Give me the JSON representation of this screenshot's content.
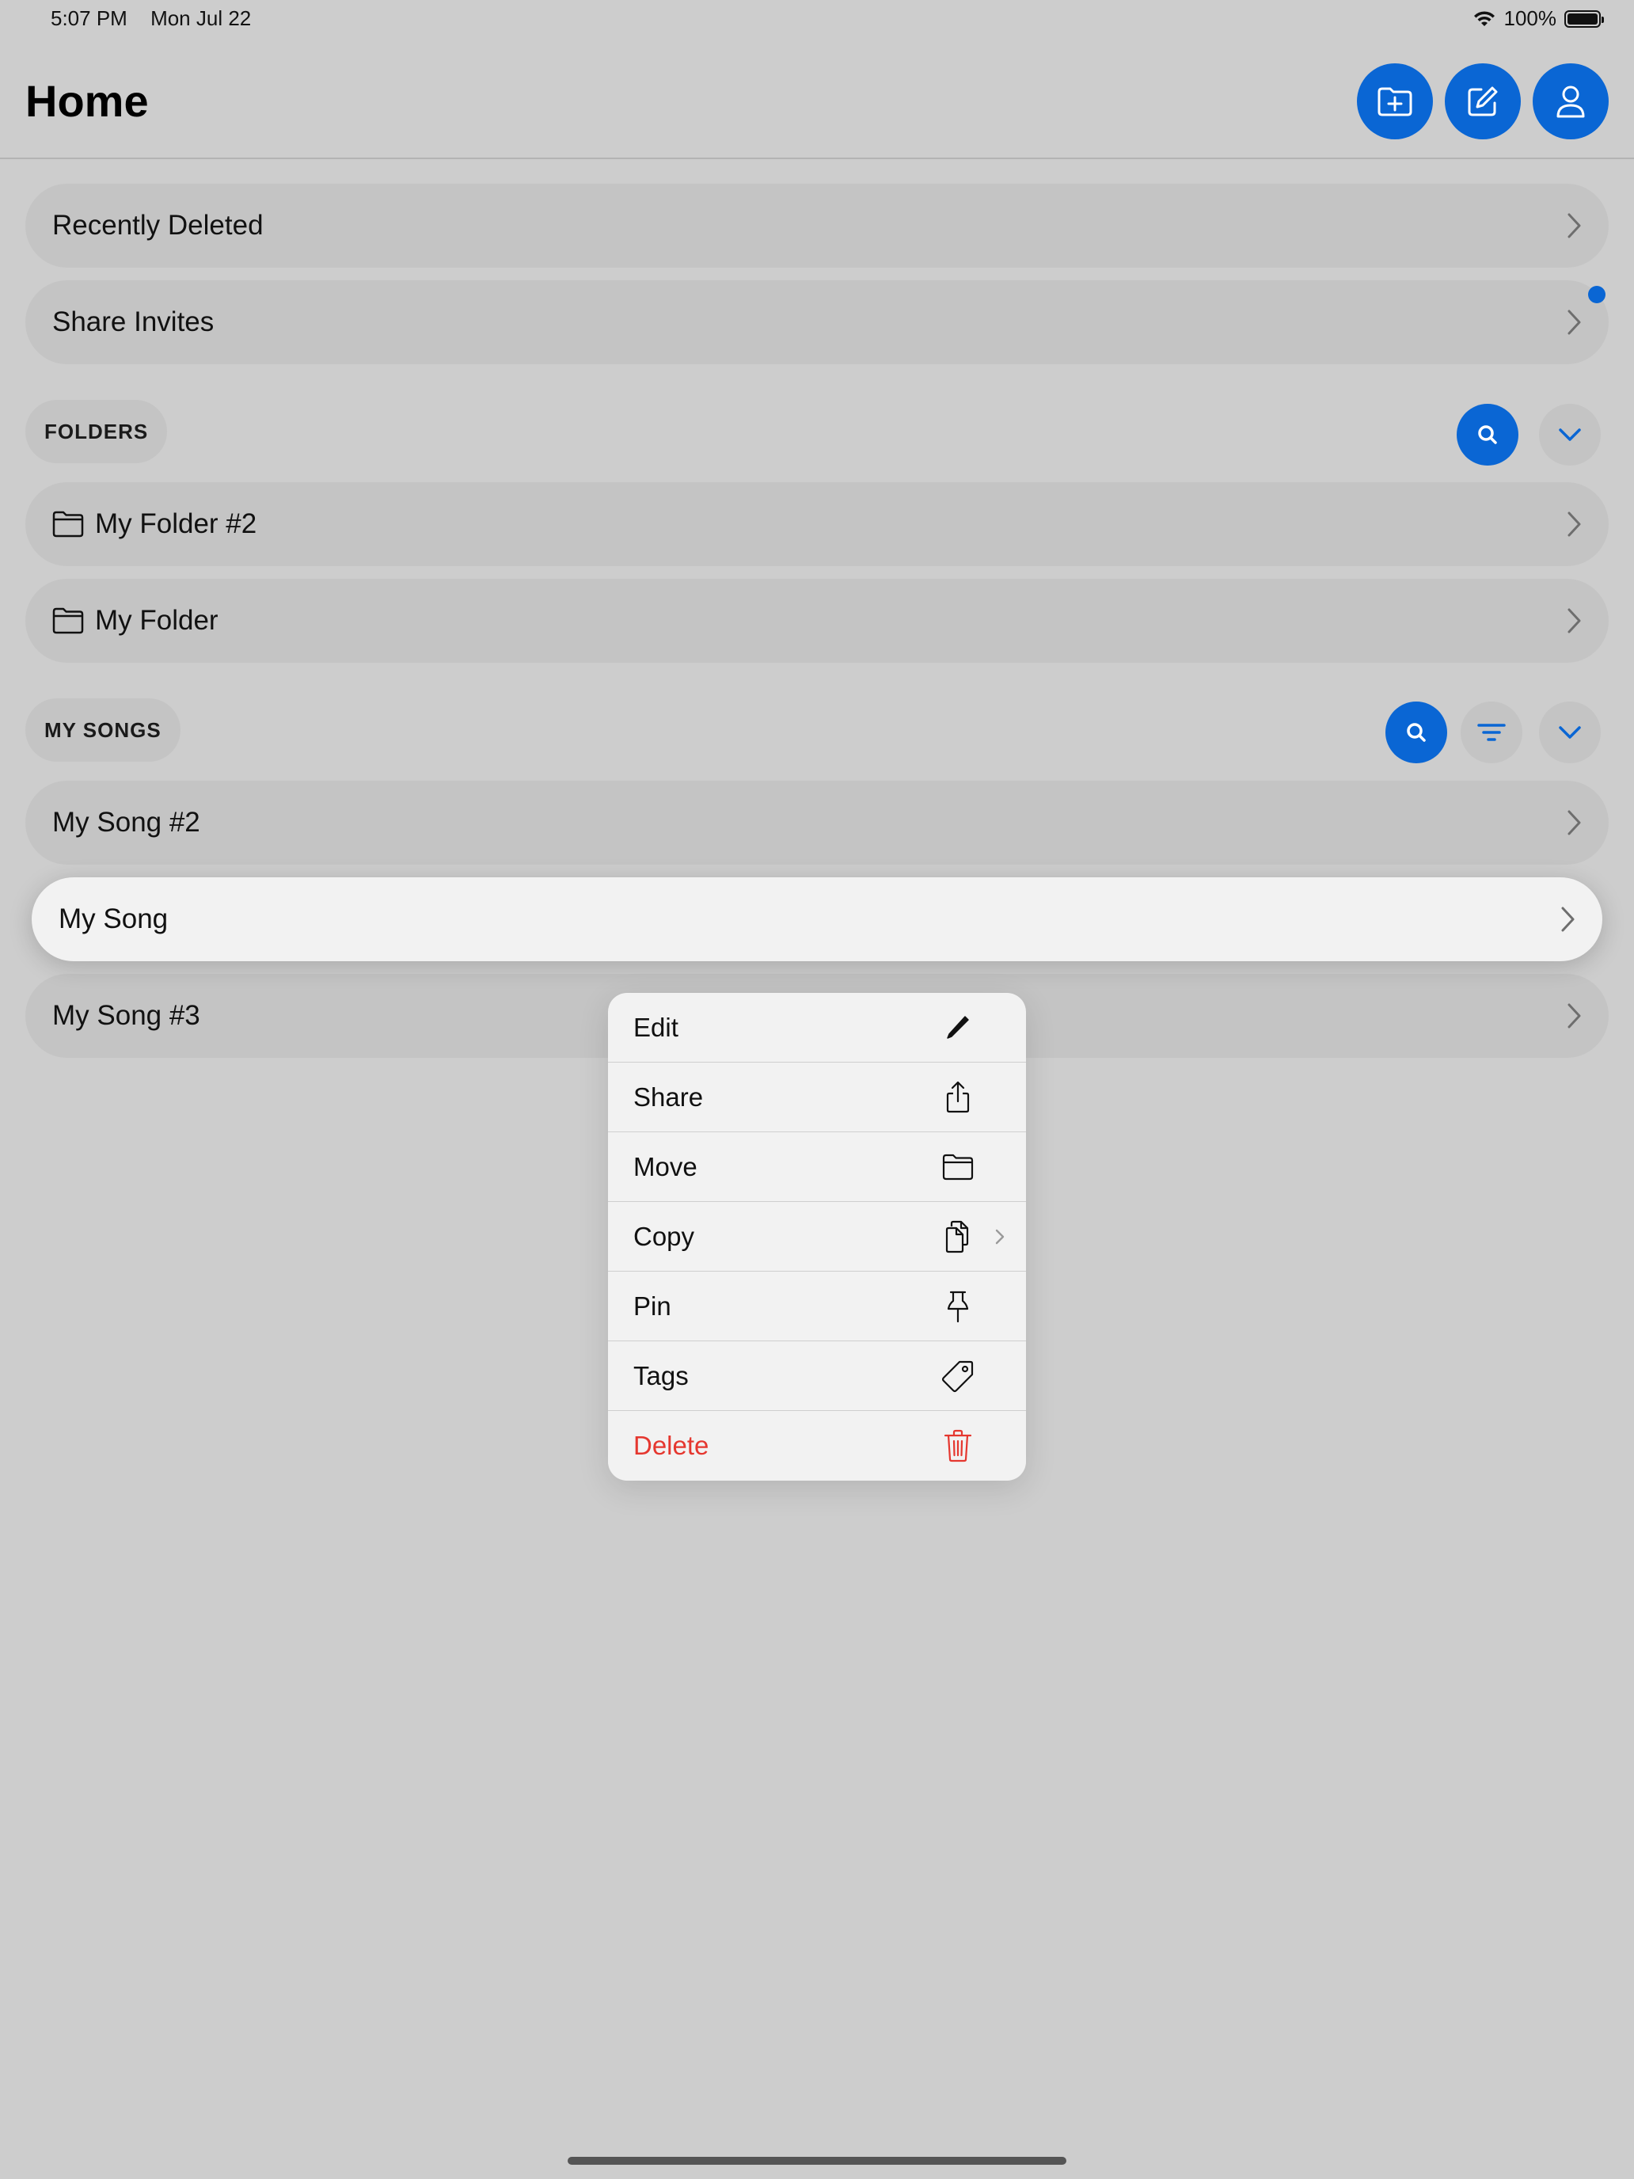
{
  "status_bar": {
    "time": "5:07 PM",
    "date": "Mon Jul 22",
    "battery": "100%",
    "icons": [
      "wifi-icon",
      "battery-icon"
    ]
  },
  "header": {
    "title": "Home",
    "buttons": [
      "new-folder-icon",
      "compose-icon",
      "person-icon"
    ]
  },
  "top_rows": [
    {
      "label": "Recently Deleted"
    },
    {
      "label": "Share Invites",
      "has_badge": true
    }
  ],
  "folders": {
    "section_label": "FOLDERS",
    "items": [
      {
        "label": "My Folder #2"
      },
      {
        "label": "My Folder"
      }
    ]
  },
  "songs": {
    "section_label": "MY SONGS",
    "items": [
      {
        "label": "My Song #2"
      },
      {
        "label": "My Song",
        "focused": true
      },
      {
        "label": "My Song #3"
      }
    ]
  },
  "context_menu": {
    "items": [
      {
        "label": "Edit",
        "icon": "pencil-icon"
      },
      {
        "label": "Share",
        "icon": "share-icon"
      },
      {
        "label": "Move",
        "icon": "folder-icon"
      },
      {
        "label": "Copy",
        "icon": "copy-icon",
        "has_submenu": true
      },
      {
        "label": "Pin",
        "icon": "pin-icon"
      },
      {
        "label": "Tags",
        "icon": "tag-icon"
      },
      {
        "label": "Delete",
        "icon": "trash-icon",
        "destructive": true
      }
    ]
  },
  "colors": {
    "accent": "#0a66d4",
    "destructive": "#e5372f",
    "background": "#cdcdcd",
    "row": "#c4c4c4",
    "menu": "#f2f2f2"
  }
}
